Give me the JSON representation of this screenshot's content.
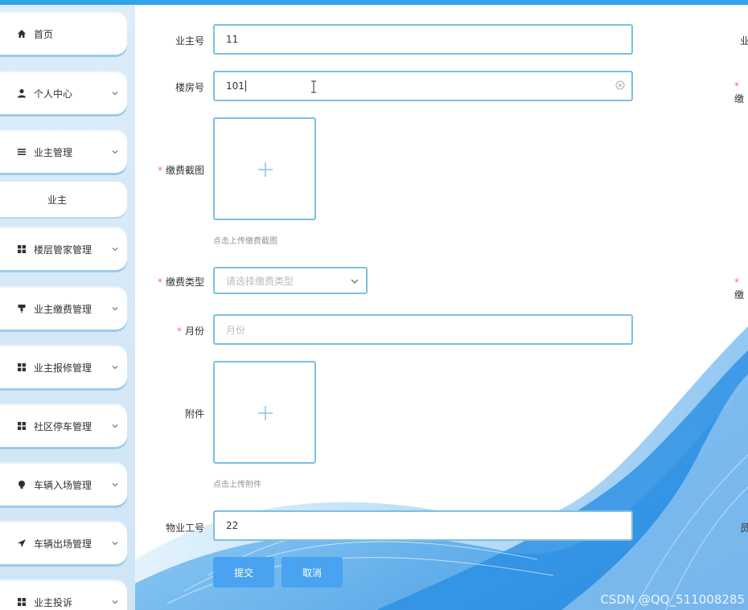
{
  "sidebar": {
    "items": [
      {
        "label": "首页",
        "icon": "home-icon",
        "has_chevron": false
      },
      {
        "label": "个人中心",
        "icon": "user-icon",
        "has_chevron": true
      },
      {
        "label": "业主管理",
        "icon": "list-icon",
        "has_chevron": true
      },
      {
        "label": "楼层管家管理",
        "icon": "grid-icon",
        "has_chevron": true
      },
      {
        "label": "业主缴费管理",
        "icon": "pin-icon",
        "has_chevron": true
      },
      {
        "label": "业主报修管理",
        "icon": "grid-icon",
        "has_chevron": true
      },
      {
        "label": "社区停车管理",
        "icon": "grid-icon",
        "has_chevron": true
      },
      {
        "label": "车辆入场管理",
        "icon": "bulb-icon",
        "has_chevron": true
      },
      {
        "label": "车辆出场管理",
        "icon": "send-icon",
        "has_chevron": true
      },
      {
        "label": "业主投诉",
        "icon": "grid-icon",
        "has_chevron": true
      }
    ],
    "sub_item": {
      "label": "业主"
    }
  },
  "form": {
    "owner_no": {
      "label": "业主号",
      "value": "11"
    },
    "room_no": {
      "label": "楼房号",
      "value": "101"
    },
    "payment_screenshot": {
      "label": "缴费截图",
      "tip": "点击上传缴费截图"
    },
    "payment_type": {
      "label": "缴费类型",
      "placeholder": "请选择缴费类型"
    },
    "month": {
      "label": "月份",
      "placeholder": "月份"
    },
    "attachment": {
      "label": "附件",
      "tip": "点击上传附件"
    },
    "staff_no": {
      "label": "物业工号",
      "value": "22"
    }
  },
  "buttons": {
    "submit": "提交",
    "cancel": "取消"
  },
  "right_edge": {
    "row1": "业",
    "row2": "缴",
    "row3": "缴",
    "row4": "员"
  },
  "watermark": "CSDN @QQ_511008285",
  "colors": {
    "accent": "#4aa3f0",
    "border": "#7cc0df",
    "required": "#f56c6c",
    "topbar": "#2fa4e7"
  }
}
